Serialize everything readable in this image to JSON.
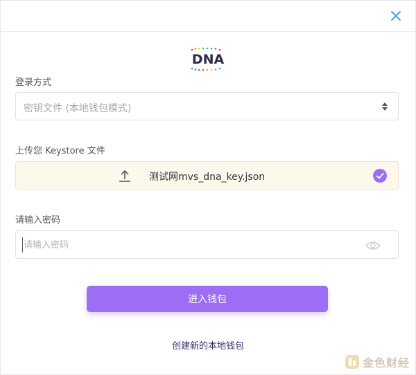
{
  "brand": {
    "logo_text": "DNA",
    "accent_color": "#9b6ef3",
    "close_icon_color": "#2b9bd6"
  },
  "login_method": {
    "label": "登录方式",
    "placeholder": "密钥文件 (本地钱包模式)",
    "caret_icon": "sort-updown-icon"
  },
  "keystore_upload": {
    "label": "上传您 Keystore 文件",
    "upload_icon": "upload-arrow-icon",
    "filename": "测试网mvs_dna_key.json",
    "status_icon": "check-circle-icon",
    "background_color": "#fdf8ec"
  },
  "password": {
    "label": "请输入密码",
    "placeholder": "请输入密码",
    "value": "",
    "toggle_icon": "eye-icon"
  },
  "actions": {
    "enter_wallet_label": "进入钱包",
    "create_wallet_label": "创建新的本地钱包"
  },
  "watermark": {
    "text": "金色财经"
  }
}
